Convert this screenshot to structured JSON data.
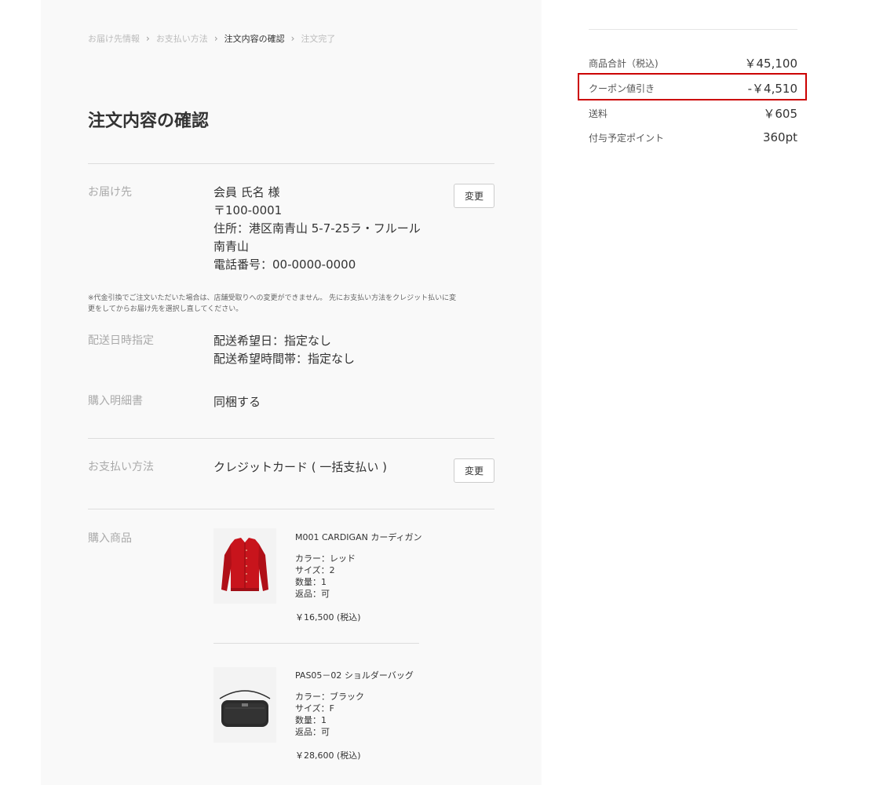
{
  "breadcrumb": {
    "steps": [
      "お届け先情報",
      "お支払い方法",
      "注文内容の確認",
      "注文完了"
    ]
  },
  "page": {
    "title": "注文内容の確認"
  },
  "shipping": {
    "label": "お届け先",
    "name": "会員 氏名 様",
    "postal": "〒100-0001",
    "address_line1": "住所：港区南青山 5-7-25ラ・フルール",
    "address_line2": "南青山",
    "phone": "電話番号：00-0000-0000",
    "change_label": "変更",
    "note": "※代金引換でご注文いただいた場合は、店舗受取りへの変更ができません。 先にお支払い方法をクレジット払いに変更をしてからお届け先を選択し直してください。"
  },
  "delivery": {
    "label": "配送日時指定",
    "date": "配送希望日：指定なし",
    "time": "配送希望時間帯：指定なし"
  },
  "statement": {
    "label": "購入明細書",
    "value": "同梱する"
  },
  "payment": {
    "label": "お支払い方法",
    "value": "クレジットカード ( 一括支払い )",
    "change_label": "変更"
  },
  "products": {
    "label": "購入商品",
    "items": [
      {
        "name": "M001 CARDIGAN カーディガン",
        "color": "カラー：レッド",
        "size": "サイズ：2",
        "qty": "数量：1",
        "returns": "返品：可",
        "price": "￥16,500 (税込)",
        "image": "red-cardigan"
      },
      {
        "name": "PAS05－02 ショルダーバッグ",
        "color": "カラー：ブラック",
        "size": "サイズ：F",
        "qty": "数量：1",
        "returns": "返品：可",
        "price": "￥28,600 (税込)",
        "image": "black-shoulder-bag"
      }
    ]
  },
  "summary": {
    "subtotal_label": "商品合計（税込)",
    "subtotal_value": "￥45,100",
    "coupon_label": "クーポン値引き",
    "coupon_value": "-￥4,510",
    "shipping_label": "送料",
    "shipping_value": "￥605",
    "points_label": "付与予定ポイント",
    "points_value": "360pt",
    "highlight_color": "#cc0000"
  }
}
